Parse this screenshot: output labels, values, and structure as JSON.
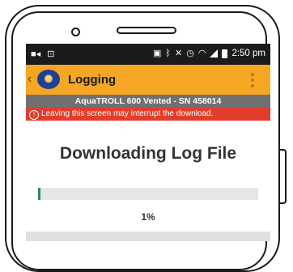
{
  "status_bar": {
    "time": "2:50 pm",
    "icons": [
      "video-icon",
      "lock-icon",
      "nfc-icon",
      "bluetooth-icon",
      "mute-icon",
      "alarm-icon",
      "wifi-icon",
      "signal-icon",
      "battery-icon"
    ]
  },
  "app_bar": {
    "title": "Logging",
    "background_color": "#f5a623"
  },
  "device_info": "AquaTROLL 600 Vented - SN 458014",
  "warning": {
    "text": "Leaving this screen may interrupt the download.",
    "color": "#e23d2c"
  },
  "main": {
    "title": "Downloading Log File",
    "progress": {
      "value": 0.01,
      "label": "1%",
      "color": "#2e8b57"
    }
  }
}
